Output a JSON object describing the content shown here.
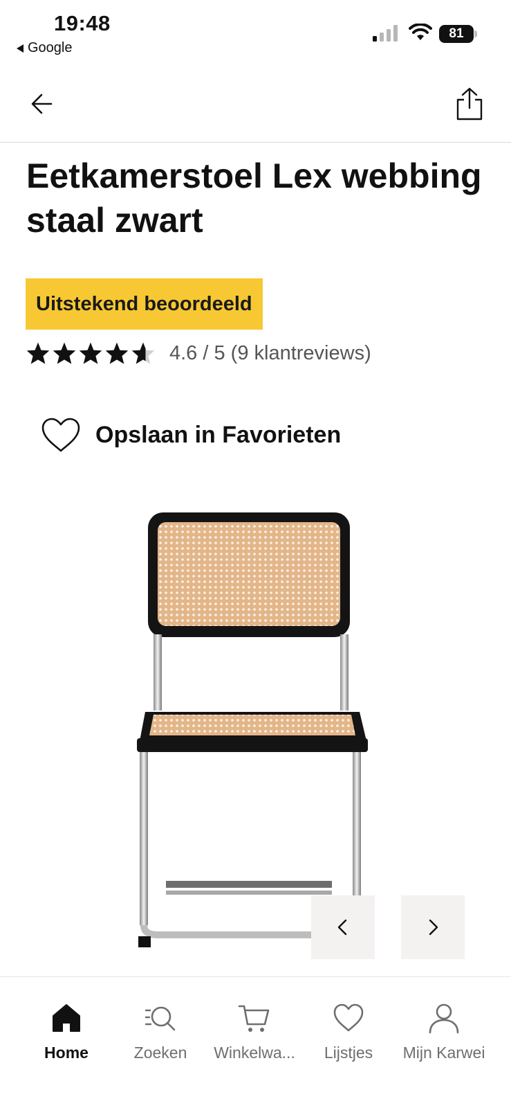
{
  "status_bar": {
    "time": "19:48",
    "back_app": "Google",
    "battery": "81"
  },
  "header": {
    "back_icon": "arrow-left-icon",
    "share_icon": "share-icon"
  },
  "product": {
    "title": "Eetkamerstoel Lex webbing staal zwart",
    "badge": "Uitstekend beoordeeld",
    "rating": 4.6,
    "rating_text": "4.6 / 5 (9 klantreviews)",
    "favorite_label": "Opslaan in Favorieten",
    "image_alt": "chair-photo"
  },
  "carousel": {
    "prev_icon": "chevron-left-icon",
    "next_icon": "chevron-right-icon"
  },
  "tab_bar": {
    "tabs": [
      {
        "label": "Home",
        "icon": "home-icon",
        "active": true
      },
      {
        "label": "Zoeken",
        "icon": "search-list-icon",
        "active": false
      },
      {
        "label": "Winkelwa...",
        "icon": "cart-icon",
        "active": false
      },
      {
        "label": "Lijstjes",
        "icon": "heart-icon",
        "active": false
      },
      {
        "label": "Mijn Karwei",
        "icon": "user-icon",
        "active": false
      }
    ]
  },
  "colors": {
    "badge_bg": "#f7c833",
    "text_primary": "#111111",
    "text_secondary": "#555555",
    "carousel_btn_bg": "#f4f2f0"
  }
}
